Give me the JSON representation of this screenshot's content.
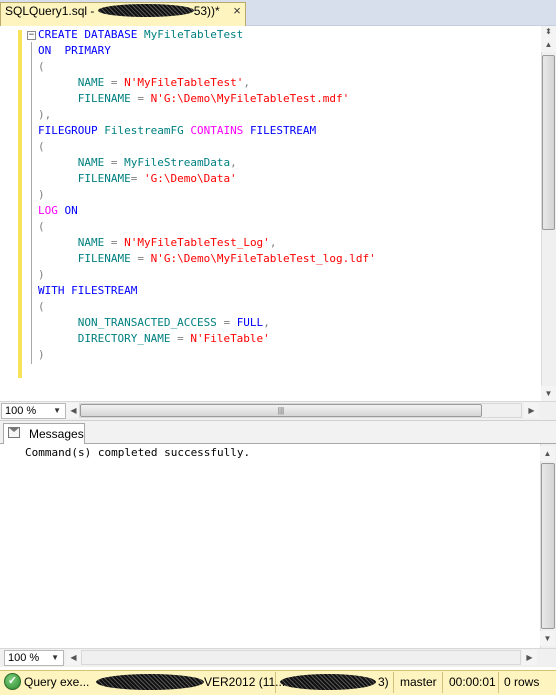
{
  "document_tab": {
    "title_prefix": "SQLQuery1.sql - ",
    "title_suffix": "53))*",
    "close_glyph": "×"
  },
  "editor": {
    "collapse_glyph": "−",
    "lines": [
      [
        {
          "t": "CREATE DATABASE ",
          "c": "kw"
        },
        {
          "t": "MyFileTableTest",
          "c": "id"
        }
      ],
      [
        {
          "t": "ON  PRIMARY",
          "c": "kw"
        }
      ],
      [
        {
          "t": "(",
          "c": "gr"
        }
      ],
      [
        {
          "t": "      NAME ",
          "c": "id"
        },
        {
          "t": "= ",
          "c": "gr"
        },
        {
          "t": "N'MyFileTableTest'",
          "c": "str"
        },
        {
          "t": ",",
          "c": "gr"
        }
      ],
      [
        {
          "t": "      FILENAME ",
          "c": "id"
        },
        {
          "t": "= ",
          "c": "gr"
        },
        {
          "t": "N'G:\\Demo\\MyFileTableTest.mdf'",
          "c": "str"
        }
      ],
      [
        {
          "t": "),",
          "c": "gr"
        }
      ],
      [
        {
          "t": "FILEGROUP ",
          "c": "kw"
        },
        {
          "t": "FilestreamFG ",
          "c": "id"
        },
        {
          "t": "CONTAINS ",
          "c": "fn"
        },
        {
          "t": "FILESTREAM",
          "c": "kw"
        }
      ],
      [
        {
          "t": "(",
          "c": "gr"
        }
      ],
      [
        {
          "t": "      NAME ",
          "c": "id"
        },
        {
          "t": "= ",
          "c": "gr"
        },
        {
          "t": "MyFileStreamData",
          "c": "id"
        },
        {
          "t": ",",
          "c": "gr"
        }
      ],
      [
        {
          "t": "      FILENAME",
          "c": "id"
        },
        {
          "t": "= ",
          "c": "gr"
        },
        {
          "t": "'G:\\Demo\\Data'",
          "c": "str"
        }
      ],
      [
        {
          "t": ")",
          "c": "gr"
        }
      ],
      [
        {
          "t": "LOG ",
          "c": "fn"
        },
        {
          "t": "ON",
          "c": "kw"
        }
      ],
      [
        {
          "t": "(",
          "c": "gr"
        }
      ],
      [
        {
          "t": "      NAME ",
          "c": "id"
        },
        {
          "t": "= ",
          "c": "gr"
        },
        {
          "t": "N'MyFileTableTest_Log'",
          "c": "str"
        },
        {
          "t": ",",
          "c": "gr"
        }
      ],
      [
        {
          "t": "      FILENAME ",
          "c": "id"
        },
        {
          "t": "= ",
          "c": "gr"
        },
        {
          "t": "N'G:\\Demo\\MyFileTableTest_log.ldf'",
          "c": "str"
        }
      ],
      [
        {
          "t": ")",
          "c": "gr"
        }
      ],
      [
        {
          "t": "WITH FILESTREAM",
          "c": "kw"
        }
      ],
      [
        {
          "t": "(",
          "c": "gr"
        }
      ],
      [
        {
          "t": "      NON_TRANSACTED_ACCESS ",
          "c": "id"
        },
        {
          "t": "= ",
          "c": "gr"
        },
        {
          "t": "FULL",
          "c": "kw"
        },
        {
          "t": ",",
          "c": "gr"
        }
      ],
      [
        {
          "t": "      DIRECTORY_NAME ",
          "c": "id"
        },
        {
          "t": "= ",
          "c": "gr"
        },
        {
          "t": "N'FileTable'",
          "c": "str"
        }
      ],
      [
        {
          "t": ")",
          "c": "gr"
        }
      ]
    ]
  },
  "editor_zoom": {
    "value": "100 %",
    "arrow": "▼"
  },
  "results": {
    "tab_label": "Messages",
    "message": "Command(s) completed successfully."
  },
  "results_zoom": {
    "value": "100 %",
    "arrow": "▼"
  },
  "scroll_glyphs": {
    "up": "▲",
    "down": "▼",
    "left": "◀",
    "right": "▶",
    "split": "⬍",
    "grip": "|||"
  },
  "statusbar": {
    "status_glyph": "✓",
    "query_status": "Query exe...",
    "server_fragment": "VER2012 (11....",
    "user_fragment": "3)",
    "database": "master",
    "elapsed": "00:00:01",
    "rows": "0 rows"
  },
  "colors": {
    "keyword": "#0000ff",
    "function": "#ff00ff",
    "string": "#ff0000",
    "operator": "#808080",
    "identifier": "#008080",
    "tab_active": "#fdf4bf",
    "change_bar": "#f7e35a"
  }
}
